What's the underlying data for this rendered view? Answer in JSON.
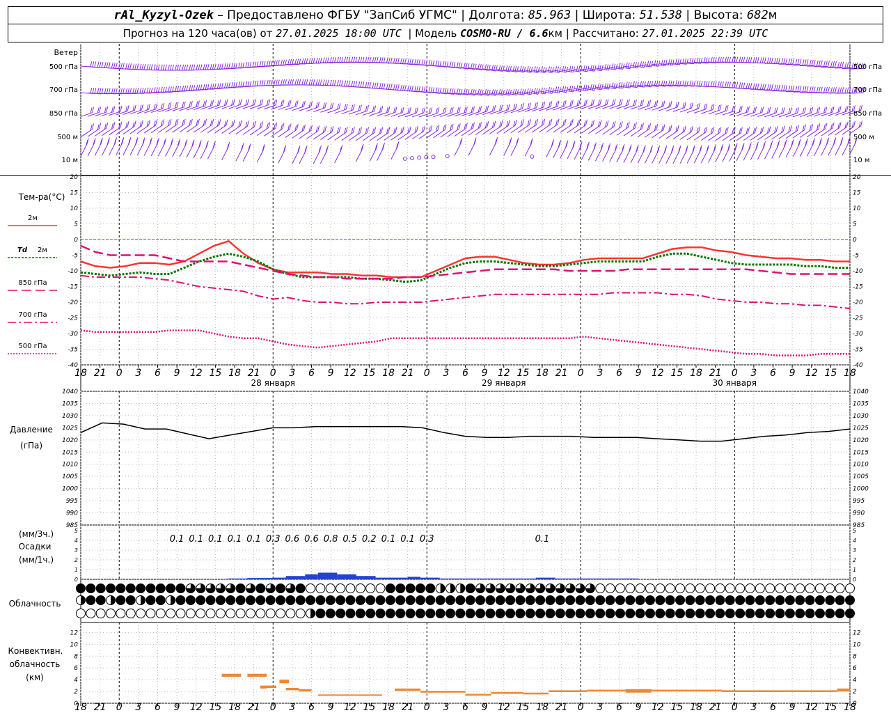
{
  "header": {
    "station": "rAl_Kyzyl-Ozek",
    "provider": "– Предоставлено ФГБУ \"ЗапСиб УГМС\"",
    "lon_label": "Долгота:",
    "lon_value": "85.963",
    "lat_label": "Широта:",
    "lat_value": "51.538",
    "alt_label": "Высота:",
    "alt_value": "682",
    "alt_unit": "м",
    "forecast_prefix": "Прогноз на 120 часа(ов) от",
    "forecast_time": "27.01.2025 18:00 UTC",
    "model_label": "Модель",
    "model_name": "COSMO-RU / 6.6",
    "model_unit": "км",
    "calc_label": "Рассчитано:",
    "calc_time": "27.01.2025 22:39 UTC"
  },
  "labels": {
    "wind": "Ветер",
    "wind_levels": [
      "500 гПа",
      "700 гПа",
      "850 гПа",
      "500 м",
      "10  м"
    ],
    "temp": "Тем-ра(°C)",
    "legend_2m": "2м",
    "legend_td_a": "Td",
    "legend_td_b": "2м",
    "legend_850": "850 гПа",
    "legend_700": "700 гПа",
    "legend_500": "500 гПа",
    "pressure_a": "Давление",
    "pressure_b": "(гПа)",
    "precip_a": "(мм/3ч.)",
    "precip_b": "Осадки",
    "precip_c": "(мм/1ч.)",
    "cloud": "Облачность",
    "conv_a": "Конвективн.",
    "conv_b": "облачность",
    "conv_c": "(км)"
  },
  "colors": {
    "wind": "#8a2be2",
    "t2m": "#ff3333",
    "td2m": "#007700",
    "t850": "#dd1177",
    "t700": "#dd1177",
    "t500": "#dd1177",
    "zero": "#4444ff",
    "pressure": "#000000",
    "precip": "#2244cc",
    "conv": "#ee8833"
  },
  "chart_data": [
    {
      "type": "wind_barbs",
      "levels": [
        "500 гПа",
        "700 гПа",
        "850 гПа",
        "500 м",
        "10  м"
      ],
      "x_hours": [
        0,
        120
      ],
      "calm_hours_10m": [
        51,
        52,
        53,
        54,
        55,
        57,
        70
      ]
    },
    {
      "type": "line",
      "ylabel": "Тем-ра(°C)",
      "ylim": [
        -40,
        20
      ],
      "yticks": [
        20,
        15,
        10,
        5,
        0,
        -5,
        -10,
        -15,
        -20,
        -25,
        -30,
        -35,
        -40
      ],
      "x_hours": [
        0,
        3,
        6,
        9,
        12,
        15,
        18,
        21,
        24,
        27,
        30,
        33,
        36,
        39,
        42,
        45,
        48,
        51,
        54,
        57,
        60,
        63,
        66,
        69,
        72,
        75,
        78,
        81,
        84,
        87,
        90,
        93,
        96,
        99,
        102,
        105,
        108,
        111,
        114,
        117,
        120
      ],
      "series": [
        {
          "name": "2м",
          "values": [
            -7,
            -8.5,
            -9,
            -8.5,
            -7.5,
            -7.5,
            -8,
            -7,
            -4.5,
            -2,
            -0.5,
            -4.5,
            -7.5,
            -9.5,
            -10.5,
            -10.5,
            -10.5,
            -11,
            -11,
            -11.5,
            -11.5,
            -12,
            -12,
            -12,
            -10,
            -8,
            -6,
            -5.5,
            -5.5,
            -6.5,
            -7.5,
            -8,
            -8,
            -7.5,
            -6.5,
            -6,
            -6,
            -6,
            -6,
            -4.5,
            -3,
            -2.5,
            -2.5,
            -3.5,
            -4,
            -5,
            -5.5,
            -6,
            -6,
            -6.5,
            -6.5,
            -7,
            -7
          ]
        },
        {
          "name": "Td 2м",
          "values": [
            -10.5,
            -11,
            -11.5,
            -11,
            -10.5,
            -11,
            -11,
            -9,
            -7,
            -5.5,
            -4.5,
            -5.5,
            -7,
            -9.5,
            -11,
            -12,
            -12,
            -12,
            -12,
            -12.5,
            -12.5,
            -13,
            -13.5,
            -13,
            -11,
            -9,
            -7.5,
            -7,
            -7,
            -7.5,
            -8,
            -8.5,
            -8.5,
            -8,
            -7.5,
            -7,
            -7,
            -7,
            -7,
            -5.5,
            -4.5,
            -4.5,
            -5.5,
            -6.5,
            -7.5,
            -8,
            -8,
            -8,
            -8,
            -8.5,
            -8.5,
            -9,
            -9
          ]
        },
        {
          "name": "850 гПа",
          "values": [
            -2,
            -4,
            -5,
            -5,
            -5,
            -5,
            -6,
            -7,
            -7,
            -7,
            -7,
            -8,
            -9,
            -10,
            -11,
            -11.5,
            -12,
            -12,
            -12.5,
            -12.5,
            -12.5,
            -12.5,
            -12,
            -12,
            -11.5,
            -11,
            -10.5,
            -10,
            -9.5,
            -9.5,
            -9.5,
            -9.5,
            -9.5,
            -10,
            -10,
            -10,
            -10,
            -9.5,
            -9.5,
            -9.5,
            -9.5,
            -9.5,
            -9.5,
            -9.5,
            -9.5,
            -9.5,
            -10,
            -10.5,
            -11,
            -11,
            -11,
            -11,
            -11
          ]
        },
        {
          "name": "700 гПа",
          "values": [
            -11.5,
            -12,
            -12,
            -12,
            -12,
            -12.5,
            -13,
            -14,
            -15,
            -15.5,
            -16,
            -16.5,
            -18,
            -19,
            -18.5,
            -19.5,
            -20,
            -20,
            -20.5,
            -20.5,
            -20,
            -20,
            -20,
            -20,
            -19.5,
            -19,
            -18.5,
            -18,
            -17.5,
            -17.5,
            -17.5,
            -17.5,
            -17.5,
            -17.5,
            -17.5,
            -17.5,
            -17,
            -17,
            -17,
            -17,
            -17.5,
            -17.5,
            -18,
            -19,
            -19.5,
            -20,
            -20,
            -20.5,
            -20.5,
            -21,
            -21,
            -21.5,
            -22
          ]
        },
        {
          "name": "500 гПа",
          "values": [
            -29,
            -29.5,
            -29.5,
            -29.5,
            -29.5,
            -29.5,
            -29,
            -29,
            -29,
            -30,
            -31,
            -31.5,
            -31.5,
            -32.5,
            -33.5,
            -34,
            -34.5,
            -34,
            -33.5,
            -33,
            -32.5,
            -31.5,
            -31.5,
            -31.5,
            -31.5,
            -31.5,
            -31.5,
            -31.5,
            -31.5,
            -31.5,
            -31.5,
            -31.5,
            -31.5,
            -31.5,
            -31,
            -31.5,
            -32,
            -32.5,
            -33,
            -33.5,
            -34,
            -34.5,
            -35,
            -35.5,
            -36,
            -36.5,
            -36.5,
            -37,
            -37,
            -37,
            -36.5,
            -36.5,
            -36.5
          ]
        }
      ]
    },
    {
      "type": "line",
      "ylabel": "Давление (гПа)",
      "ylim": [
        985,
        1040
      ],
      "yticks": [
        1040,
        1035,
        1030,
        1025,
        1020,
        1015,
        1010,
        1005,
        1000,
        995,
        990,
        985
      ],
      "x_hours": [
        0,
        3,
        6,
        9,
        12,
        15,
        18,
        21,
        24,
        27,
        30,
        33,
        36,
        39,
        42,
        45,
        48,
        51,
        54,
        57,
        60,
        63,
        66,
        69,
        72,
        75,
        78,
        81,
        84,
        87,
        90,
        93,
        96,
        99,
        102,
        105,
        108,
        111,
        114,
        117,
        120
      ],
      "series": [
        {
          "name": "Давление",
          "values": [
            1023,
            1027,
            1026.5,
            1024.5,
            1024.5,
            1022.5,
            1020.5,
            1022,
            1023.5,
            1025,
            1025,
            1025.5,
            1025.5,
            1025.5,
            1025.5,
            1025.5,
            1025,
            1023,
            1021.5,
            1021,
            1021,
            1021.5,
            1021.5,
            1021.5,
            1021,
            1021,
            1021,
            1020.5,
            1020,
            1019.5,
            1019.5,
            1020.5,
            1021.5,
            1022,
            1023,
            1023.5,
            1024.5
          ]
        }
      ]
    },
    {
      "type": "bar",
      "ylabel": "Осадки (мм/3ч.) (мм/1ч.)",
      "ylim": [
        0,
        5
      ],
      "yticks": [
        5,
        4,
        3,
        2,
        1,
        0
      ],
      "labels_3h": [
        {
          "hour": 15,
          "value": "0.1"
        },
        {
          "hour": 18,
          "value": "0.1"
        },
        {
          "hour": 21,
          "value": "0.1"
        },
        {
          "hour": 24,
          "value": "0.1"
        },
        {
          "hour": 27,
          "value": "0.1"
        },
        {
          "hour": 30,
          "value": "0.3"
        },
        {
          "hour": 33,
          "value": "0.6"
        },
        {
          "hour": 36,
          "value": "0.6"
        },
        {
          "hour": 39,
          "value": "0.8"
        },
        {
          "hour": 42,
          "value": "0.5"
        },
        {
          "hour": 45,
          "value": "0.2"
        },
        {
          "hour": 48,
          "value": "0.1"
        },
        {
          "hour": 51,
          "value": "0.1"
        },
        {
          "hour": 54,
          "value": "0.3"
        },
        {
          "hour": 72,
          "value": "0.1"
        }
      ],
      "hourly": [
        {
          "from": 23,
          "to": 26,
          "value": 0.05
        },
        {
          "from": 26,
          "to": 30,
          "value": 0.08
        },
        {
          "from": 30,
          "to": 32,
          "value": 0.1
        },
        {
          "from": 32,
          "to": 35,
          "value": 0.2
        },
        {
          "from": 35,
          "to": 37,
          "value": 0.3
        },
        {
          "from": 37,
          "to": 40,
          "value": 0.4
        },
        {
          "from": 40,
          "to": 43,
          "value": 0.3
        },
        {
          "from": 43,
          "to": 46,
          "value": 0.2
        },
        {
          "from": 46,
          "to": 47,
          "value": 0.1
        },
        {
          "from": 47,
          "to": 49,
          "value": 0.1
        },
        {
          "from": 49,
          "to": 51,
          "value": 0.1
        },
        {
          "from": 51,
          "to": 53,
          "value": 0.15
        },
        {
          "from": 53,
          "to": 56,
          "value": 0.1
        },
        {
          "from": 56,
          "to": 58,
          "value": 0.05
        },
        {
          "from": 58,
          "to": 60,
          "value": 0.05
        },
        {
          "from": 60,
          "to": 62,
          "value": 0.05
        },
        {
          "from": 62,
          "to": 64,
          "value": 0.05
        },
        {
          "from": 64,
          "to": 68,
          "value": 0.05
        },
        {
          "from": 68,
          "to": 71,
          "value": 0.05
        },
        {
          "from": 71,
          "to": 74,
          "value": 0.1
        },
        {
          "from": 74,
          "to": 78,
          "value": 0.05
        },
        {
          "from": 78,
          "to": 81,
          "value": 0.05
        },
        {
          "from": 81,
          "to": 84,
          "value": 0.05
        },
        {
          "from": 84,
          "to": 87,
          "value": 0.05
        }
      ]
    },
    {
      "type": "cloud_cover",
      "rows": [
        "upper",
        "middle",
        "lower"
      ]
    },
    {
      "type": "bar",
      "ylabel": "Конвективн. облачность (км)",
      "ylim": [
        0,
        13
      ],
      "yticks": [
        12,
        10,
        8,
        6,
        4,
        2,
        0
      ],
      "segments": [
        {
          "from": 22,
          "to": 25,
          "bottom": 4.5,
          "top": 5
        },
        {
          "from": 26,
          "to": 29,
          "bottom": 4.5,
          "top": 5
        },
        {
          "from": 28,
          "to": 29,
          "bottom": 2.5,
          "top": 3
        },
        {
          "from": 29,
          "to": 30.5,
          "bottom": 2.6,
          "top": 3
        },
        {
          "from": 31,
          "to": 32.5,
          "bottom": 3.4,
          "top": 4
        },
        {
          "from": 32,
          "to": 34,
          "bottom": 2.2,
          "top": 2.6
        },
        {
          "from": 34,
          "to": 36,
          "bottom": 2,
          "top": 2.4
        },
        {
          "from": 37,
          "to": 43,
          "bottom": 1.3,
          "top": 1.5
        },
        {
          "from": 43,
          "to": 47,
          "bottom": 1.3,
          "top": 1.5
        },
        {
          "from": 49,
          "to": 53,
          "bottom": 2.1,
          "top": 2.5
        },
        {
          "from": 53,
          "to": 60,
          "bottom": 1.8,
          "top": 2.1
        },
        {
          "from": 60,
          "to": 64,
          "bottom": 1.3,
          "top": 1.6
        },
        {
          "from": 64,
          "to": 69,
          "bottom": 1.6,
          "top": 1.9
        },
        {
          "from": 69,
          "to": 73,
          "bottom": 1.5,
          "top": 1.8
        },
        {
          "from": 73,
          "to": 79,
          "bottom": 1.9,
          "top": 2.2
        },
        {
          "from": 79,
          "to": 85,
          "bottom": 2,
          "top": 2.3
        },
        {
          "from": 85,
          "to": 89,
          "bottom": 1.8,
          "top": 2.4
        },
        {
          "from": 89,
          "to": 95,
          "bottom": 2,
          "top": 2.3
        },
        {
          "from": 95,
          "to": 100,
          "bottom": 2,
          "top": 2.3
        },
        {
          "from": 100,
          "to": 105,
          "bottom": 1.9,
          "top": 2.2
        },
        {
          "from": 105,
          "to": 118,
          "bottom": 1.9,
          "top": 2.2
        },
        {
          "from": 118,
          "to": 120,
          "bottom": 2,
          "top": 2.5
        }
      ]
    }
  ],
  "x_axis": {
    "tick_labels": [
      "18",
      "21",
      "0",
      "3",
      "6",
      "9",
      "12",
      "15",
      "18",
      "21",
      "0",
      "3",
      "6",
      "9",
      "12",
      "15",
      "18",
      "21",
      "0",
      "3",
      "6",
      "9",
      "12",
      "15",
      "18",
      "21",
      "0",
      "3",
      "6",
      "9",
      "12",
      "15",
      "18",
      "21",
      "0"
    ],
    "day_labels": [
      {
        "hour": 18,
        "text": "28 января"
      },
      {
        "hour": 54,
        "text": "29 января"
      },
      {
        "hour": 90,
        "text": "30 января"
      }
    ]
  }
}
